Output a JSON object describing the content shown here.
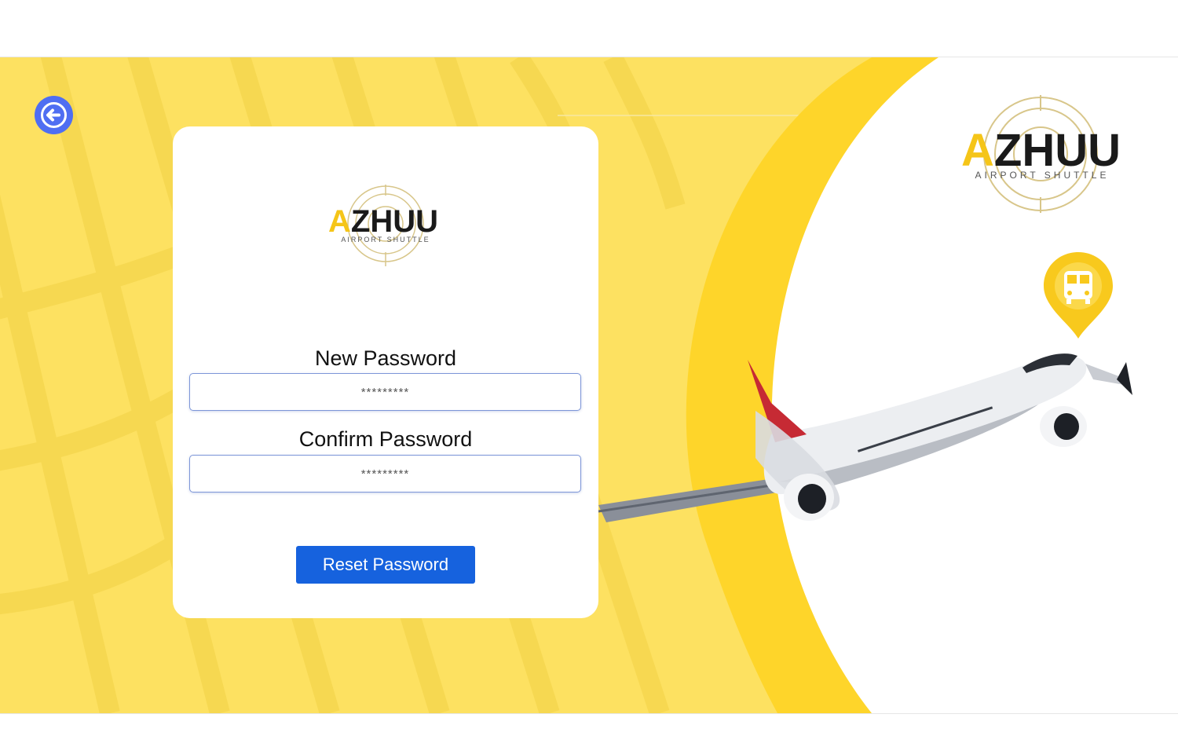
{
  "logo": {
    "accent_letter": "A",
    "rest": "ZHUU",
    "tagline": "AIRPORT SHUTTLE",
    "accent_color": "#f5c518",
    "text_color": "#1a1a1a"
  },
  "back_button": {
    "icon": "arrow-left-icon"
  },
  "form": {
    "new_password_label": "New Password",
    "new_password_placeholder": "*********",
    "confirm_password_label": "Confirm Password",
    "confirm_password_placeholder": "*********",
    "submit_label": "Reset Password"
  },
  "decor": {
    "location_pin_icon": "bus-icon",
    "illustration": "airplane"
  },
  "colors": {
    "background_yellow": "#fde161",
    "arc_yellow": "#fed52a",
    "primary_blue": "#1662de",
    "back_button_blue": "#4f6ef2"
  }
}
